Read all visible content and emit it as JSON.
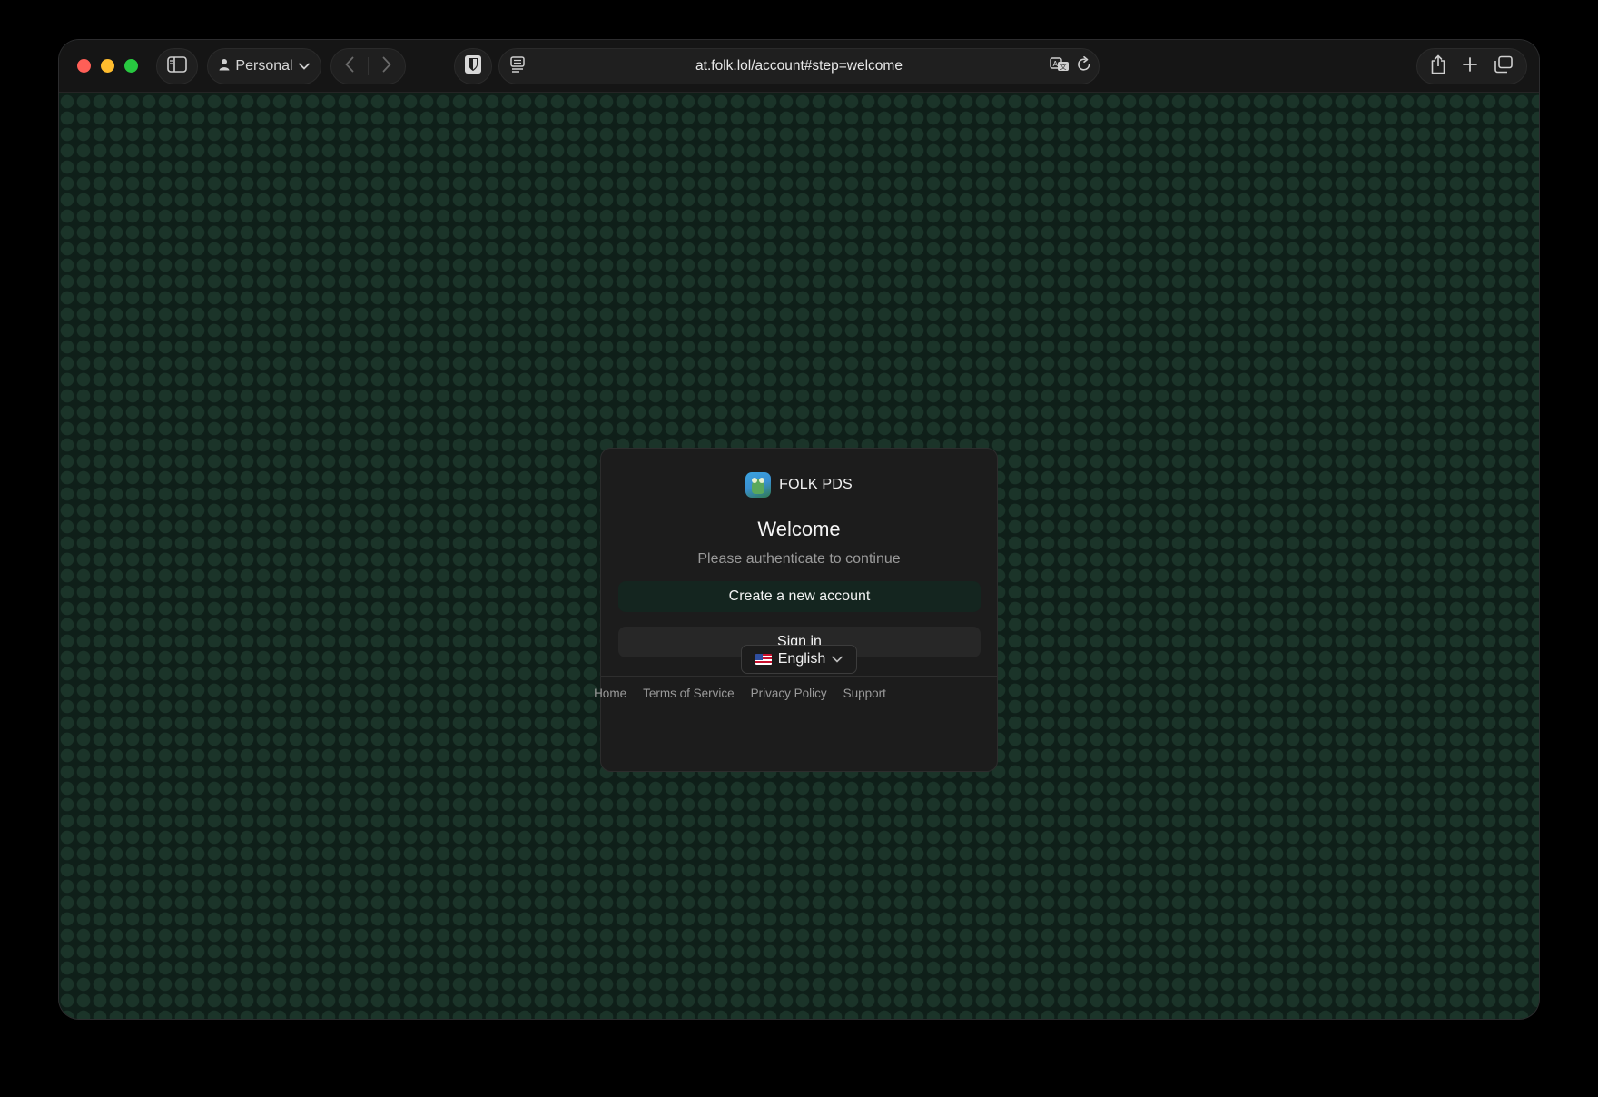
{
  "browser": {
    "profile_label": "Personal",
    "url": "at.folk.lol/account#step=welcome",
    "icons": {
      "sidebar": "sidebar-icon",
      "profile": "person-icon",
      "back": "chevron-left-icon",
      "forward": "chevron-right-icon",
      "shield": "shield-icon",
      "reader": "reader-icon",
      "translate": "translate-icon",
      "reload": "reload-icon",
      "share": "share-icon",
      "new_tab": "plus-icon",
      "tabs": "tabs-overview-icon"
    }
  },
  "card": {
    "brand_name": "FOLK PDS",
    "title": "Welcome",
    "subtitle": "Please authenticate to continue",
    "create_account_label": "Create a new account",
    "sign_in_label": "Sign in",
    "language_label": "English",
    "links": {
      "home": "Home",
      "terms": "Terms of Service",
      "privacy": "Privacy Policy",
      "support": "Support"
    }
  },
  "colors": {
    "background": "#0f1f19",
    "card": "#1c1c1c",
    "primary_button": "#14251f",
    "secondary_button": "#272727"
  }
}
